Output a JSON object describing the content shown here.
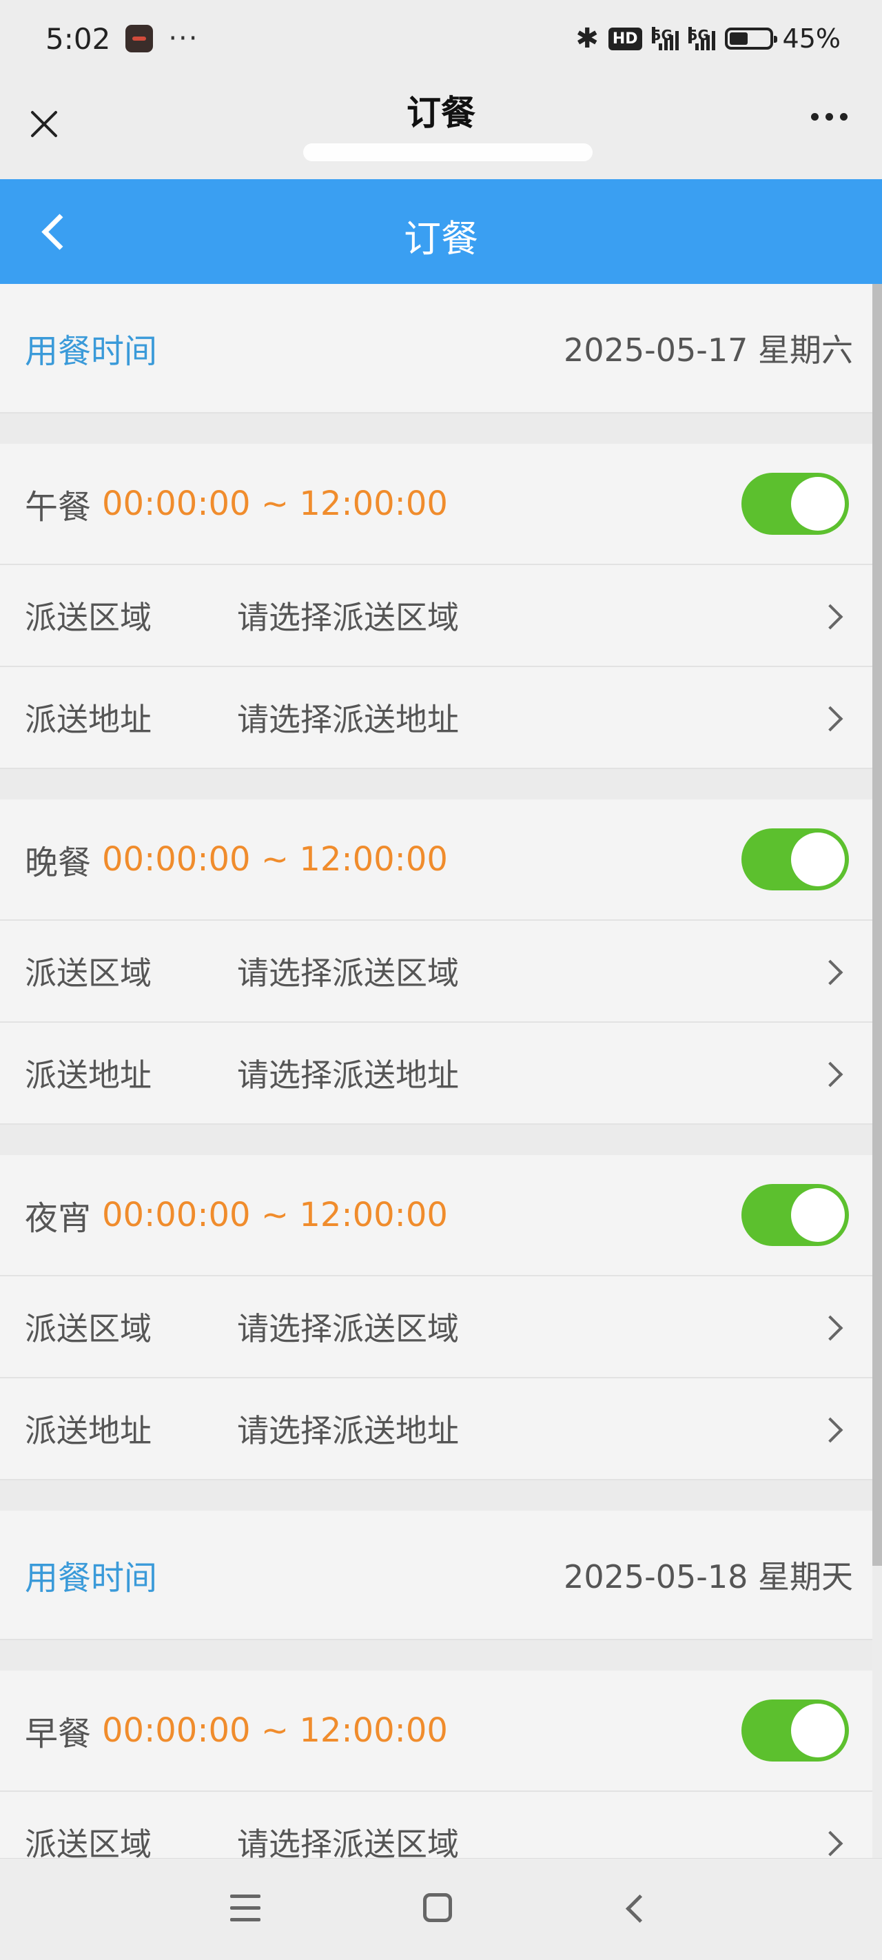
{
  "status_bar": {
    "time": "5:02",
    "dots": "···",
    "hd": "HD",
    "net1": "5G",
    "net2": "5G",
    "battery": "45%"
  },
  "wx_bar": {
    "title": "订餐"
  },
  "header": {
    "title": "订餐"
  },
  "days": [
    {
      "label": "用餐时间",
      "date": "2025-05-17 星期六",
      "meals": [
        {
          "name": "午餐",
          "time": "00:00:00 ~ 12:00:00",
          "enabled": true,
          "rows": [
            {
              "label": "派送区域",
              "value": "请选择派送区域"
            },
            {
              "label": "派送地址",
              "value": "请选择派送地址"
            }
          ]
        },
        {
          "name": "晚餐",
          "time": "00:00:00 ~ 12:00:00",
          "enabled": true,
          "rows": [
            {
              "label": "派送区域",
              "value": "请选择派送区域"
            },
            {
              "label": "派送地址",
              "value": "请选择派送地址"
            }
          ]
        },
        {
          "name": "夜宵",
          "time": "00:00:00 ~ 12:00:00",
          "enabled": true,
          "rows": [
            {
              "label": "派送区域",
              "value": "请选择派送区域"
            },
            {
              "label": "派送地址",
              "value": "请选择派送地址"
            }
          ]
        }
      ]
    },
    {
      "label": "用餐时间",
      "date": "2025-05-18 星期天",
      "meals": [
        {
          "name": "早餐",
          "time": "00:00:00 ~ 12:00:00",
          "enabled": true,
          "rows": [
            {
              "label": "派送区域",
              "value": "请选择派送区域"
            }
          ]
        }
      ]
    }
  ],
  "colors": {
    "header_blue": "#3a9ff2",
    "label_blue": "#3a9ad9",
    "time_orange": "#f08c2c",
    "toggle_green": "#5cc02e"
  }
}
